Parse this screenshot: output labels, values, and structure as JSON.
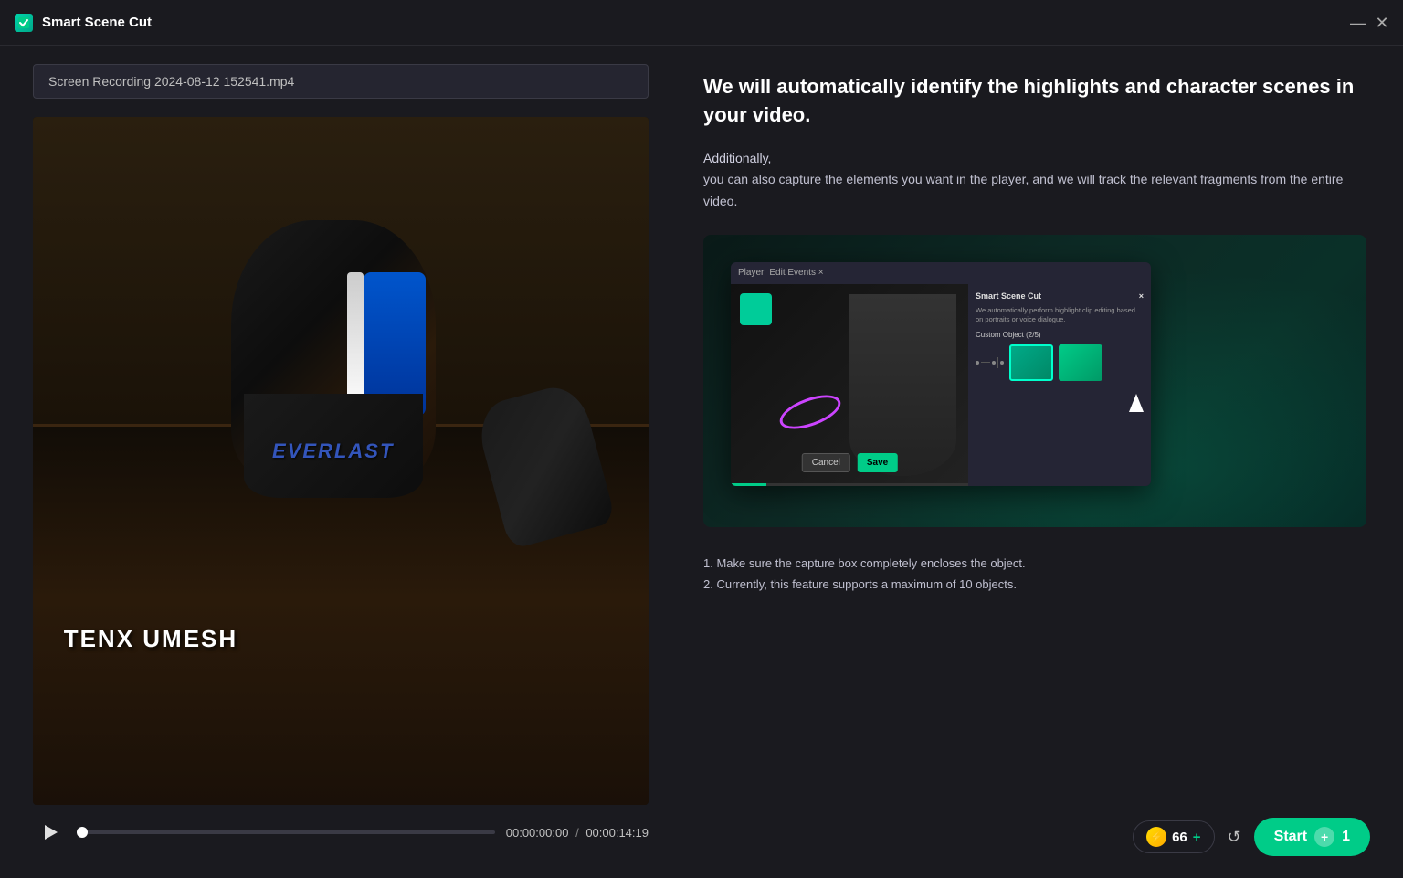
{
  "app": {
    "title": "Smart Scene Cut"
  },
  "titlebar": {
    "minimize_label": "—",
    "close_label": "✕"
  },
  "left_panel": {
    "file_path": "Screen Recording 2024-08-12 152541.mp4",
    "player": {
      "current_time": "00:00:00:00",
      "total_time": "00:00:14:19",
      "separator": "/"
    },
    "video": {
      "brand_text": "EVERLAST",
      "name_overlay": "TENX UMESH"
    }
  },
  "right_panel": {
    "headline": "We will automatically identify the highlights and character scenes in your video.",
    "additionally_label": "Additionally,",
    "additionally_body": "you can also capture the elements you want in the player, and we will track the relevant fragments from the entire video.",
    "notes": [
      "1. Make sure the capture box completely encloses the object.",
      "2. Currently, this feature supports a maximum of 10 objects."
    ],
    "inner_dialog": {
      "title": "Smart Scene Cut",
      "description": "We automatically perform highlight clip editing based on portraits or voice dialogue.",
      "custom_object_label": "Custom Object (2/5)"
    }
  },
  "bottom_controls": {
    "coin_count": "66",
    "plus_label": "+",
    "start_label": "Start",
    "start_number": "1",
    "start_plus": "+"
  }
}
